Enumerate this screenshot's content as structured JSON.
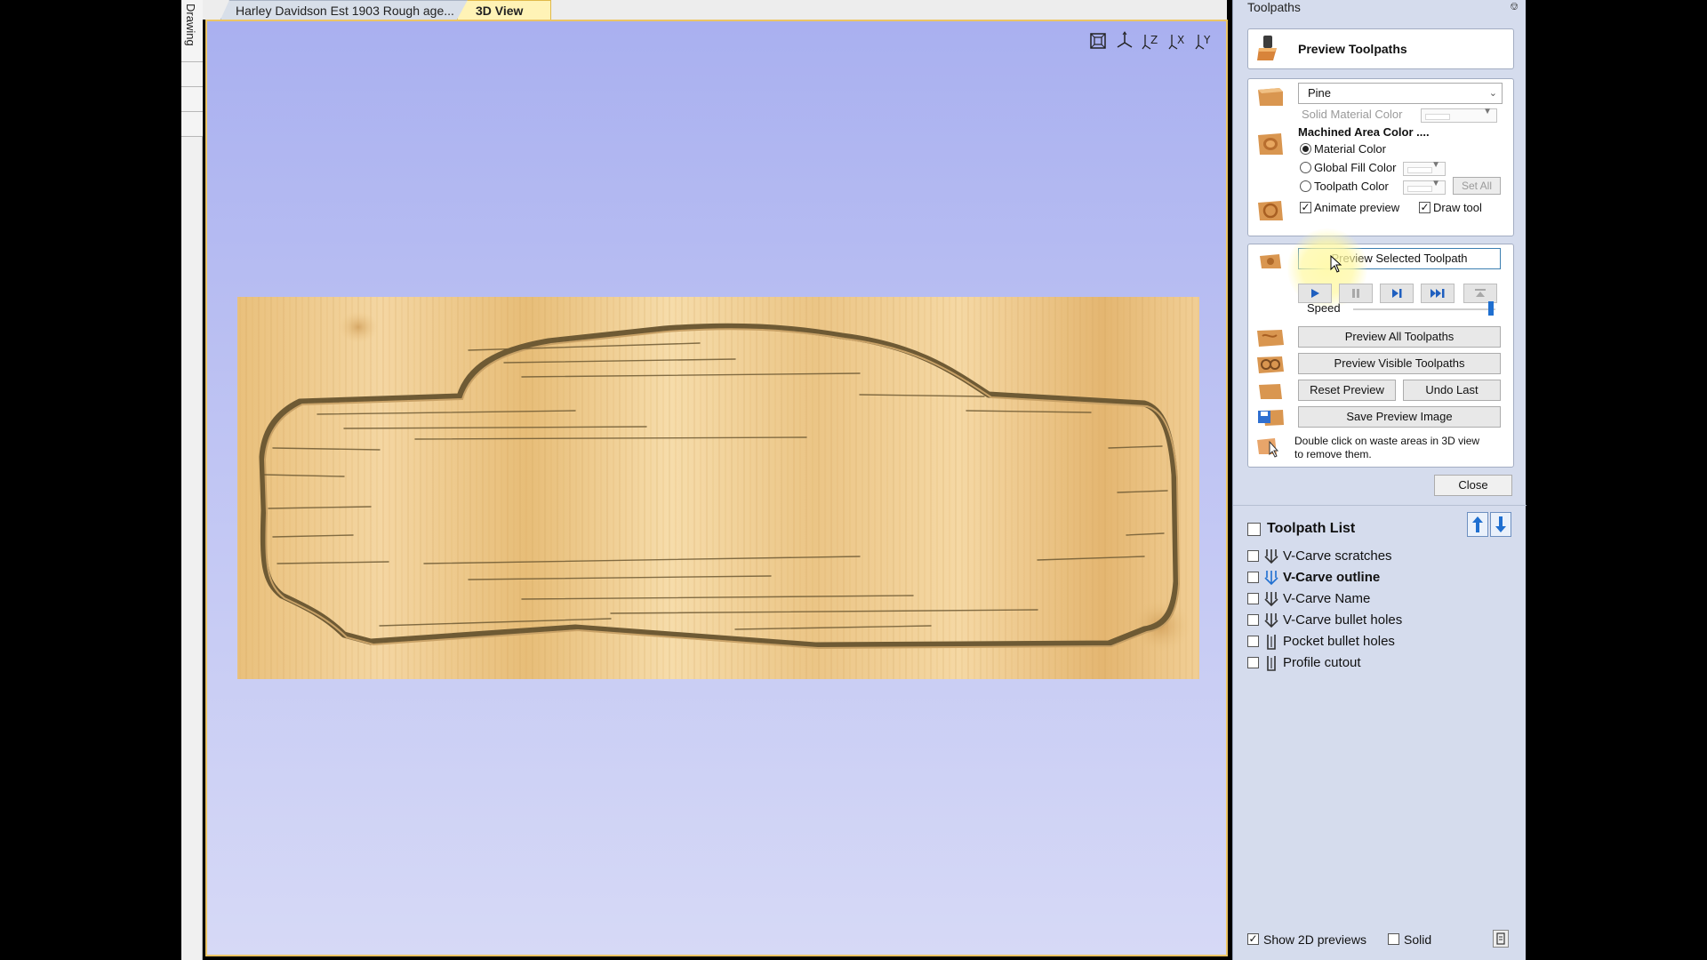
{
  "left_strip": {
    "drawing_tab": "Drawing"
  },
  "tabs": [
    {
      "label": "Harley Davidson Est 1903 Rough age..."
    },
    {
      "label": "3D View"
    }
  ],
  "view_toolbar": {
    "icons": [
      "zoom-extents-icon",
      "iso-view-icon",
      "z-view-icon",
      "x-view-icon",
      "y-view-icon"
    ],
    "labels": [
      "Z",
      "X",
      "Y"
    ]
  },
  "panel": {
    "title": "Toolpaths",
    "header": "Preview Toolpaths",
    "material": {
      "selected": "Pine",
      "solid_material_color_label": "Solid Material Color",
      "machined_area_title": "Machined Area Color ....",
      "options": [
        "Material Color",
        "Global Fill Color",
        "Toolpath Color"
      ],
      "selected_option": "Material Color",
      "set_all_label": "Set All",
      "animate_preview_label": "Animate preview",
      "draw_tool_label": "Draw tool",
      "animate_preview_checked": true,
      "draw_tool_checked": true
    },
    "preview": {
      "preview_selected_label": "Preview Selected Toolpath",
      "speed_label": "Speed",
      "speed_level": 0.97,
      "preview_all_label": "Preview All Toolpaths",
      "preview_visible_label": "Preview Visible Toolpaths",
      "reset_preview_label": "Reset Preview",
      "undo_last_label": "Undo Last",
      "save_preview_image_label": "Save Preview Image",
      "hint_line1": "Double click on waste areas in 3D view",
      "hint_line2": "to remove them."
    },
    "close_label": "Close",
    "toolpath_list": {
      "title": "Toolpath List",
      "items": [
        {
          "name": "V-Carve scratches",
          "type": "vcarve",
          "bold": false
        },
        {
          "name": "V-Carve outline",
          "type": "vcarve",
          "bold": true
        },
        {
          "name": "V-Carve Name",
          "type": "vcarve",
          "bold": false
        },
        {
          "name": "V-Carve bullet holes",
          "type": "vcarve",
          "bold": false
        },
        {
          "name": "Pocket bullet holes",
          "type": "pocket",
          "bold": false
        },
        {
          "name": "Profile cutout",
          "type": "profile",
          "bold": false
        }
      ]
    },
    "bottom": {
      "show_2d_label": "Show 2D previews",
      "show_2d_checked": true,
      "solid_label": "Solid",
      "solid_checked": false
    }
  },
  "colors": {
    "viewport_sky_top": "#a9b0f0",
    "wood_light": "#f3d39a",
    "wood_dark": "#d9a95c",
    "tab_active": "#fff3b6",
    "accent_blue": "#1f6fd0"
  }
}
